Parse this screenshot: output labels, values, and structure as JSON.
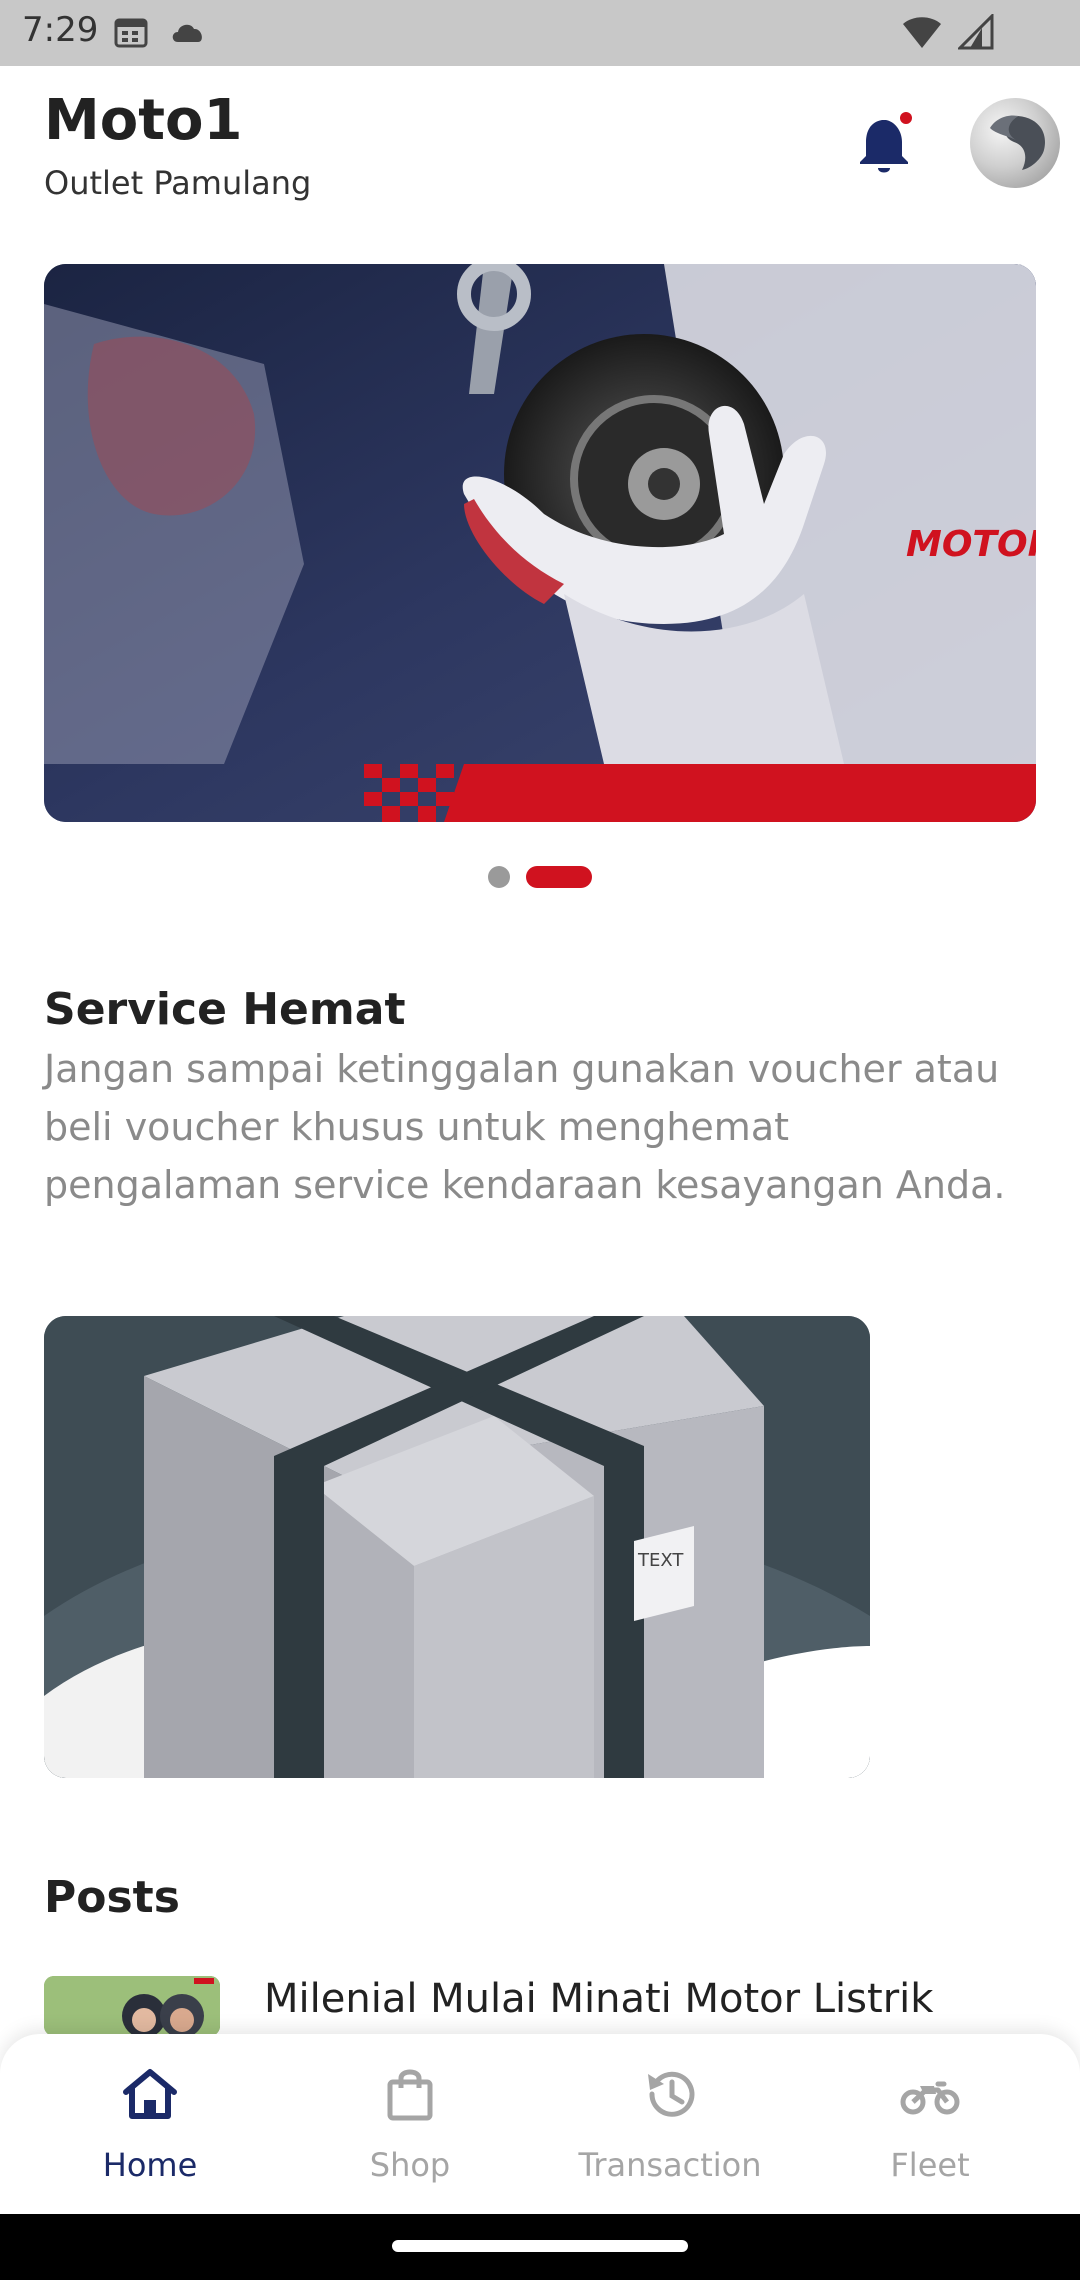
{
  "status_bar": {
    "time": "7:29",
    "icons": [
      "calendar-icon",
      "cloud-icon",
      "wifi-icon",
      "signal-icon"
    ]
  },
  "header": {
    "title": "Moto1",
    "subtitle": "Outlet Pamulang",
    "notification_badge": true
  },
  "banner": {
    "brand_text": "MOTORIZ",
    "carousel": {
      "count": 2,
      "active_index": 1
    }
  },
  "promo_section": {
    "title": "Service Hemat",
    "description": "Jangan sampai ketinggalan gunakan voucher atau beli voucher khusus untuk menghemat pengalaman service kendaraan kesayangan Anda.",
    "box_label": "TEXT"
  },
  "posts_section": {
    "title": "Posts",
    "items": [
      {
        "title": "Milenial Mulai Minati Motor Listrik"
      }
    ]
  },
  "bottom_nav": {
    "items": [
      {
        "label": "Home",
        "icon": "home-icon",
        "active": true
      },
      {
        "label": "Shop",
        "icon": "shopping-bag-icon",
        "active": false
      },
      {
        "label": "Transaction",
        "icon": "history-icon",
        "active": false
      },
      {
        "label": "Fleet",
        "icon": "motorcycle-icon",
        "active": false
      }
    ]
  },
  "colors": {
    "brand_red": "#d0121f",
    "nav_active": "#1b2a68",
    "nav_inactive": "#a5a5a5",
    "bell": "#1b2a68",
    "status_bar_bg": "#c8c8c8"
  }
}
